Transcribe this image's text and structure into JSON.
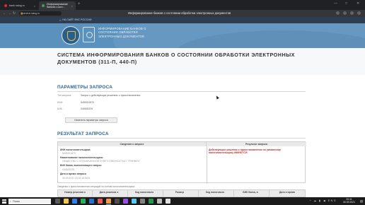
{
  "browser": {
    "tabs": [
      {
        "label": "bank.nalog.ru"
      },
      {
        "label": "Информирование банков о сост..."
      }
    ],
    "new_tab": "+",
    "window_controls": [
      "—",
      "□",
      "✕"
    ],
    "address": "service.nalog.ru",
    "page_title": "Информирование банков о состоянии обработки электронных документов"
  },
  "site": {
    "home_link": "НА САЙТ ФНС РОССИИ",
    "banner_text": "ИНФОРМИРОВАНИЕ БАНКОВ О СОСТОЯНИИ ОБРАБОТКИ ЭЛЕКТРОННЫХ ДОКУМЕНТОВ",
    "system_title": "СИСТЕМА ИНФОРМИРОВАНИЯ БАНКОВ О СОСТОЯНИИ ОБРАБОТКИ ЭЛЕКТРОННЫХ ДОКУМЕНТОВ (311-П, 440-П)"
  },
  "params": {
    "title": "ПАРАМЕТРЫ ЗАПРОСА",
    "rows": [
      {
        "label": "Тип запроса:",
        "value": "Запрос о действующих решениях о приостановлении"
      },
      {
        "label": "ИНН:",
        "value": "5405191570"
      },
      {
        "label": "БИК:",
        "value": "044525225"
      }
    ],
    "change_button": "Изменить параметры запроса"
  },
  "result": {
    "title": "РЕЗУЛЬТАТ ЗАПРОСА",
    "col_info": "Сведения о запросе",
    "col_result": "Результат запроса",
    "fields": [
      {
        "label": "ИНН налогоплательщика:",
        "value": "5405191570"
      },
      {
        "label": "Наименование налогоплательщика:",
        "value": "ОБЩЕСТВО С ОГРАНИЧЕННОЙ ОТВЕТСТВЕННОСТЬЮ \"ГРИНВИЧ\""
      },
      {
        "label": "БИК банка, выполняющего запрос:",
        "value": "044525225"
      },
      {
        "label": "Дата и время запроса",
        "value": "30.09.2021 20:32:15 МСК"
      }
    ],
    "result_text": "Действующие решения о приостановлении по указанному налогоплательщику ИМЕЮТСЯ"
  },
  "decisions": {
    "note": "Сведения о приостановлении операций по счетам налогоплательщика:",
    "columns": [
      "Номер решения о",
      "Дата решения о",
      "Код налогового",
      "Размер",
      "Код налогового",
      "БИК банка, в",
      "Дата и время"
    ]
  },
  "taskbar": {
    "search_placeholder": "Поиск",
    "tray_icons": "^ ☁ ▮ ◀ ENG",
    "time": "20:41",
    "date": "30.09.2021"
  }
}
